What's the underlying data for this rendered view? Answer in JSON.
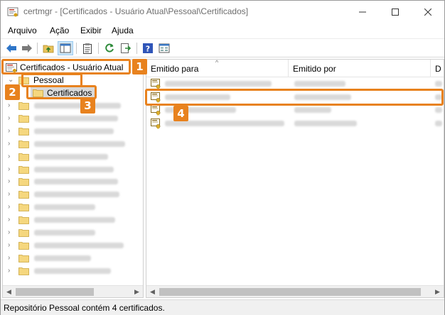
{
  "window": {
    "title": "certmgr - [Certificados - Usuário Atual\\Pessoal\\Certificados]",
    "controls": {
      "minimize_icon": "minimize-icon",
      "maximize_icon": "maximize-icon",
      "close_icon": "close-icon"
    }
  },
  "menu": {
    "items": [
      "Arquivo",
      "Ação",
      "Exibir",
      "Ajuda"
    ]
  },
  "toolbar": {
    "buttons": [
      "back-arrow-icon",
      "forward-arrow-icon",
      "up-folder-icon",
      "show-hide-tree-icon",
      "clipboard-icon",
      "refresh-icon",
      "export-list-icon",
      "help-icon",
      "properties-view-icon"
    ]
  },
  "tree": {
    "root": "Certificados - Usuário Atual",
    "pessoal": "Pessoal",
    "certificados": "Certificados",
    "collapsed_item_count": 14
  },
  "list": {
    "columns": [
      "Emitido para",
      "Emitido por",
      "D"
    ],
    "row_count": 4,
    "selected_row": 2
  },
  "status": {
    "text": "Repositório Pessoal contém 4 certificados."
  },
  "callouts": [
    "1",
    "2",
    "3",
    "4"
  ],
  "colors": {
    "callout": "#e8821e",
    "selection": "#d9d9d9",
    "toolbar_active": "#cde6f7"
  }
}
